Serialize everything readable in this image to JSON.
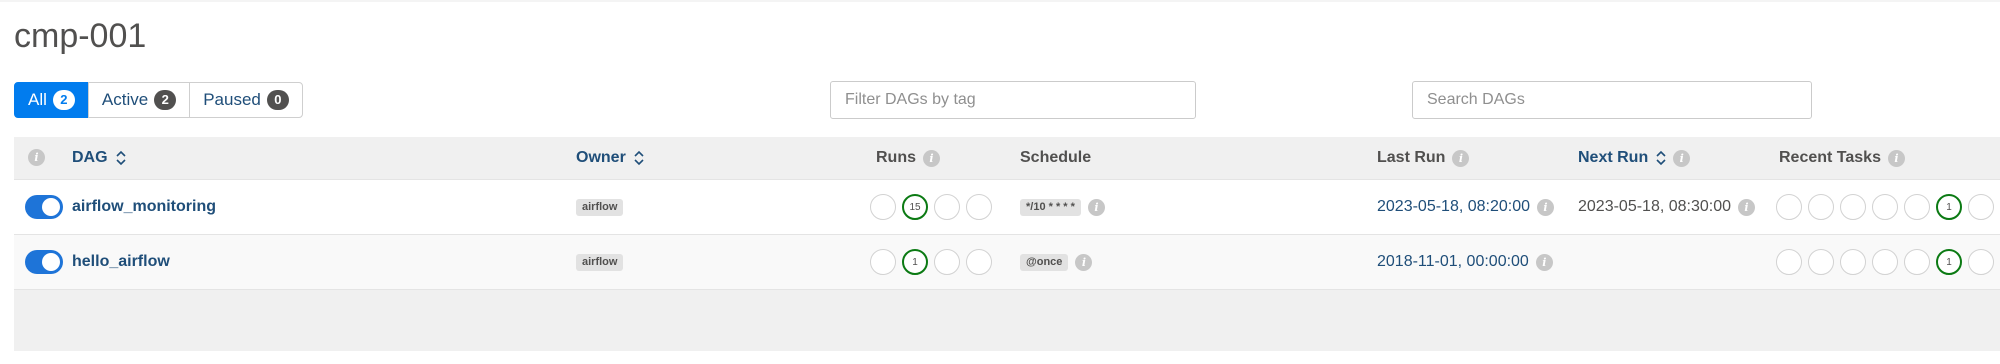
{
  "page": {
    "title": "cmp-001"
  },
  "filters": [
    {
      "label": "All",
      "count": "2",
      "active": true
    },
    {
      "label": "Active",
      "count": "2",
      "active": false
    },
    {
      "label": "Paused",
      "count": "0",
      "active": false
    }
  ],
  "tag_filter": {
    "placeholder": "Filter DAGs by tag"
  },
  "search": {
    "placeholder": "Search DAGs"
  },
  "columns": {
    "dag": "DAG",
    "owner": "Owner",
    "runs": "Runs",
    "schedule": "Schedule",
    "last_run": "Last Run",
    "next_run": "Next Run",
    "recent_tasks": "Recent Tasks"
  },
  "icons": {
    "info": "i"
  },
  "colors": {
    "accent": "#017cee",
    "link": "#1f4e79",
    "success": "#0b7a13",
    "toggle_on": "#1e74d8"
  },
  "dags": [
    {
      "name": "airflow_monitoring",
      "enabled": true,
      "owner": "airflow",
      "runs": [
        "",
        "15",
        "",
        ""
      ],
      "schedule": "*/10 * * * *",
      "last_run": "2023-05-18, 08:20:00",
      "next_run": "2023-05-18, 08:30:00",
      "recent_tasks": [
        "",
        "",
        "",
        "",
        "",
        "1",
        ""
      ]
    },
    {
      "name": "hello_airflow",
      "enabled": true,
      "owner": "airflow",
      "runs": [
        "",
        "1",
        "",
        ""
      ],
      "schedule": "@once",
      "last_run": "2018-11-01, 00:00:00",
      "next_run": "",
      "recent_tasks": [
        "",
        "",
        "",
        "",
        "",
        "1",
        ""
      ]
    }
  ]
}
